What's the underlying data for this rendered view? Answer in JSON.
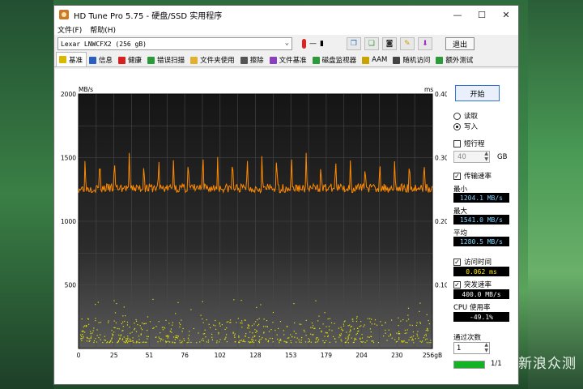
{
  "window": {
    "title": "HD Tune Pro 5.75 - 硬盘/SSD 实用程序",
    "controls": {
      "minimize": "—",
      "maximize": "☐",
      "close": "✕"
    }
  },
  "menu": {
    "file": "文件(F)",
    "help": "帮助(H)"
  },
  "toolbar": {
    "drive": "Lexar   LNWCFX2 (256 gB)",
    "temperature": "—",
    "exit_label": "退出",
    "icons": [
      "copy-info-icon",
      "copy-screen-icon",
      "camera-icon",
      "options-icon",
      "save-icon"
    ]
  },
  "tabs": [
    {
      "label": "基准",
      "icon": "bulb-icon",
      "color": "#d9b800"
    },
    {
      "label": "信息",
      "icon": "info-icon",
      "color": "#2a5fbf"
    },
    {
      "label": "健康",
      "icon": "cross-icon",
      "color": "#d92020"
    },
    {
      "label": "错误扫描",
      "icon": "magnifier-icon",
      "color": "#2c9a3a"
    },
    {
      "label": "文件夹使用",
      "icon": "folder-icon",
      "color": "#e0b030"
    },
    {
      "label": "擦除",
      "icon": "trash-icon",
      "color": "#555555"
    },
    {
      "label": "文件基准",
      "icon": "doc-icon",
      "color": "#8a3fbf"
    },
    {
      "label": "磁盘监视器",
      "icon": "monitor-icon",
      "color": "#2c9a3a"
    },
    {
      "label": "AAM",
      "icon": "speaker-icon",
      "color": "#c9a300"
    },
    {
      "label": "随机访问",
      "icon": "grid-icon",
      "color": "#444444"
    },
    {
      "label": "额外测试",
      "icon": "extra-icon",
      "color": "#2c9a3a"
    }
  ],
  "chart_data": {
    "type": "line",
    "ylabel_left": "MB/s",
    "ylabel_right": "ms",
    "ylim_left": [
      0,
      2000
    ],
    "ylim_right": [
      0,
      0.4
    ],
    "yticks_left": [
      "2000",
      "1500",
      "1000",
      "500"
    ],
    "yticks_right": [
      "0.40",
      "0.30",
      "0.20",
      "0.10"
    ],
    "xlim": [
      0,
      256
    ],
    "xticks": [
      "0",
      "25",
      "51",
      "76",
      "102",
      "128",
      "153",
      "179",
      "204",
      "230",
      "256gB"
    ],
    "series": [
      {
        "kind": "transfer",
        "color": "#ff8a00",
        "baseline": 1260,
        "peak": 1541,
        "peaks": 24
      },
      {
        "kind": "access",
        "color": "#e6e600",
        "min": 0.01,
        "max": 0.08
      }
    ],
    "grid": true
  },
  "side": {
    "start_label": "开始",
    "read_label": "读取",
    "write_label": "写入",
    "mode_selected": "write",
    "short_stroke_label": "短行程",
    "short_stroke_checked": false,
    "short_stroke_value": "40",
    "short_stroke_unit": "GB",
    "transfer_rate_label": "传输速率",
    "transfer_rate_checked": true,
    "min_label": "最小",
    "min_value": "1204.1 MB/s",
    "max_label": "最大",
    "max_value": "1541.0 MB/s",
    "avg_label": "平均",
    "avg_value": "1280.5 MB/s",
    "access_time_label": "访问时间",
    "access_time_checked": true,
    "access_time_value": "0.062 ms",
    "burst_rate_label": "突发速率",
    "burst_rate_checked": true,
    "burst_rate_value": "400.0 MB/s",
    "cpu_label": "CPU 使用率",
    "cpu_value": "-49.1%",
    "passes_label": "通过次数",
    "passes_value": "1",
    "progress_fraction": 1.0,
    "progress_text": "1/1"
  },
  "watermark": "新浪众测"
}
